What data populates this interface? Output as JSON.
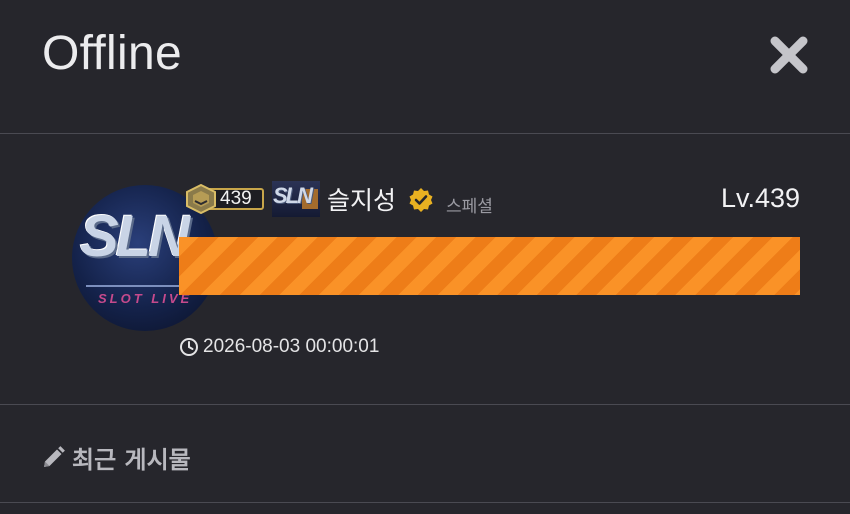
{
  "modal": {
    "title": "Offline",
    "close_icon": "close-icon"
  },
  "profile": {
    "avatar_logo_text": "SLN",
    "avatar_logo_sub": "SLOT LIVE",
    "level_badge_number": "439",
    "level_badge_icon": "level-hexagon-icon",
    "mini_logo_text": "SLN",
    "nickname": "슬지성",
    "verified_icon": "verified-badge-icon",
    "member_type": "스페셜",
    "level_label": "Lv.439",
    "exp_progress": 1.0,
    "last_seen_icon": "clock-icon",
    "last_seen": "2026-08-03 00:00:01"
  },
  "recent_posts": {
    "icon": "pencil-icon",
    "label": "최근 게시물"
  },
  "colors": {
    "background": "#26262c",
    "divider": "#4a4a52",
    "exp_bar": "#f0851f",
    "badge_gold": "#c8a64a",
    "verified": "#e9b121"
  }
}
